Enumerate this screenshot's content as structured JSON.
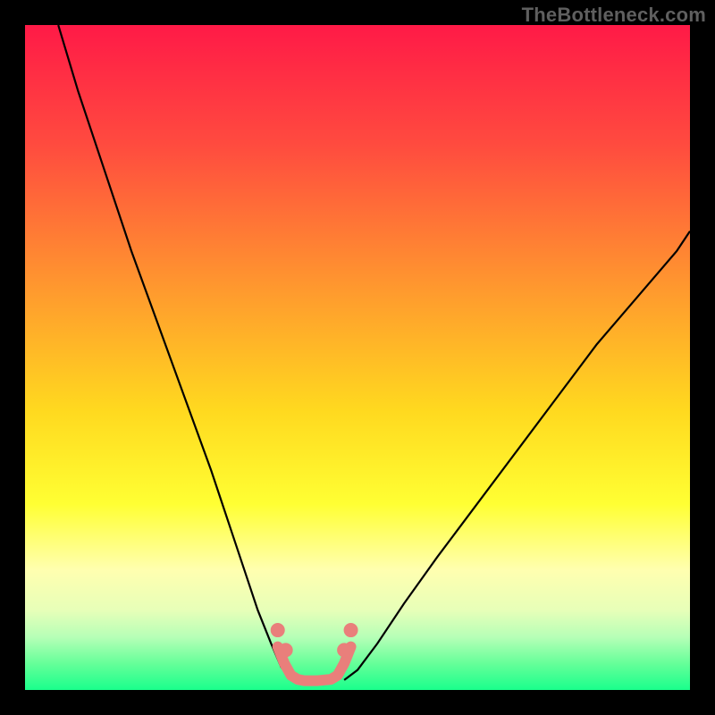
{
  "watermark": "TheBottleneck.com",
  "chart_data": {
    "type": "line",
    "title": "",
    "xlabel": "",
    "ylabel": "",
    "xlim": [
      0,
      100
    ],
    "ylim": [
      0,
      100
    ],
    "gradient_stops": [
      {
        "offset": 0.0,
        "color": "#ff1a47"
      },
      {
        "offset": 0.18,
        "color": "#ff4b3f"
      },
      {
        "offset": 0.4,
        "color": "#ff9a2e"
      },
      {
        "offset": 0.58,
        "color": "#ffd91f"
      },
      {
        "offset": 0.72,
        "color": "#ffff33"
      },
      {
        "offset": 0.82,
        "color": "#ffffb0"
      },
      {
        "offset": 0.88,
        "color": "#e7ffb8"
      },
      {
        "offset": 0.92,
        "color": "#b7ffb7"
      },
      {
        "offset": 0.96,
        "color": "#66ff99"
      },
      {
        "offset": 1.0,
        "color": "#1aff8c"
      }
    ],
    "series": [
      {
        "name": "bottleneck-curve-left",
        "stroke": "#000000",
        "width": 2.2,
        "x": [
          5,
          8,
          12,
          16,
          20,
          24,
          28,
          31,
          33,
          35,
          37,
          38.5,
          40
        ],
        "values": [
          100,
          90,
          78,
          66,
          55,
          44,
          33,
          24,
          18,
          12,
          7,
          3.5,
          1.5
        ]
      },
      {
        "name": "bottleneck-curve-right",
        "stroke": "#000000",
        "width": 2.2,
        "x": [
          48,
          50,
          53,
          57,
          62,
          68,
          74,
          80,
          86,
          92,
          98,
          100
        ],
        "values": [
          1.5,
          3,
          7,
          13,
          20,
          28,
          36,
          44,
          52,
          59,
          66,
          69
        ]
      },
      {
        "name": "highlight-band",
        "stroke": "#e97f7b",
        "width": 12,
        "linecap": "round",
        "x": [
          38,
          39,
          40,
          41,
          42,
          44,
          46,
          47,
          48,
          49
        ],
        "values": [
          6.5,
          4,
          2.2,
          1.6,
          1.4,
          1.4,
          1.6,
          2.2,
          4,
          6.5
        ]
      }
    ],
    "markers": {
      "name": "highlight-dots",
      "fill": "#e97f7b",
      "r": 8,
      "x": [
        38,
        39.2,
        48,
        49
      ],
      "values": [
        9,
        6,
        6,
        9
      ]
    }
  }
}
